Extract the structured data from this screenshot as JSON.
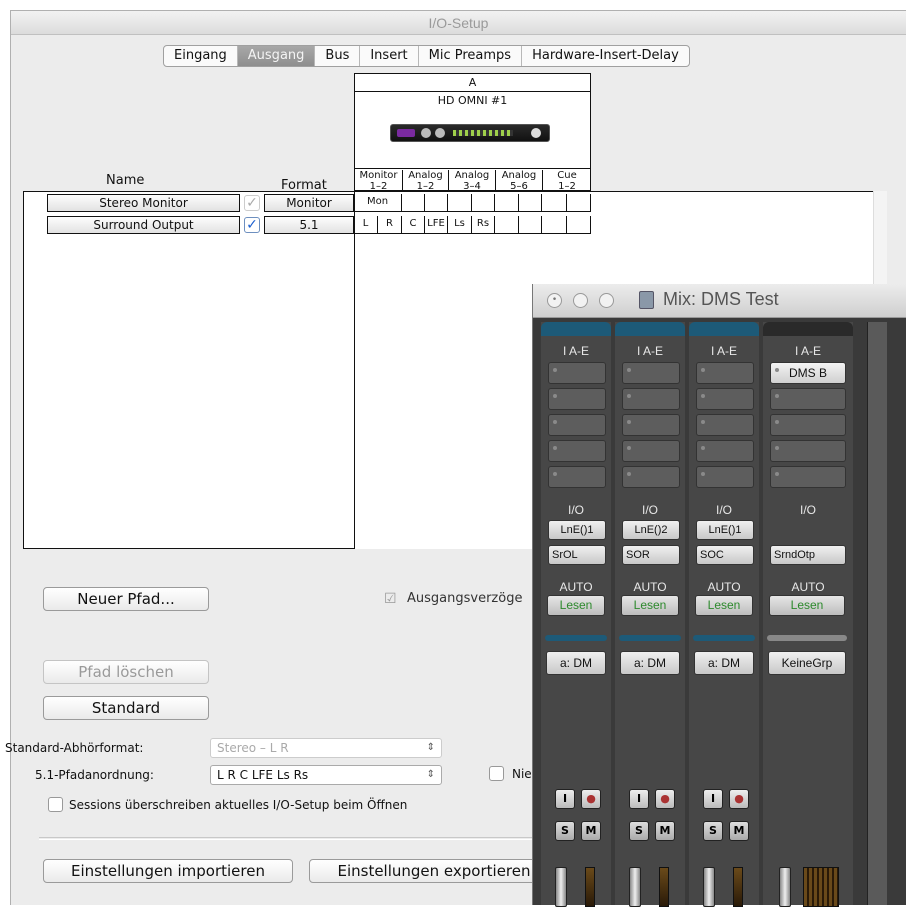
{
  "window": {
    "title": "I/O-Setup"
  },
  "tabs": [
    "Eingang",
    "Ausgang",
    "Bus",
    "Insert",
    "Mic Preamps",
    "Hardware-Insert-Delay"
  ],
  "active_tab": "Ausgang",
  "columns": {
    "name": "Name",
    "format": "Format"
  },
  "device": {
    "bank": "A",
    "name": "HD OMNI #1"
  },
  "channel_groups": [
    {
      "top": "Monitor",
      "bottom": "1–2"
    },
    {
      "top": "Analog",
      "bottom": "1–2"
    },
    {
      "top": "Analog",
      "bottom": "3–4"
    },
    {
      "top": "Analog",
      "bottom": "5–6"
    },
    {
      "top": "Cue",
      "bottom": "1–2"
    }
  ],
  "paths": [
    {
      "name": "Stereo Monitor",
      "format": "Monitor",
      "checked": true,
      "enabled": false,
      "assign": [
        "Mon"
      ]
    },
    {
      "name": "Surround Output",
      "format": "5.1",
      "checked": true,
      "enabled": true,
      "assign": [
        "L",
        "R",
        "C",
        "LFE",
        "Ls",
        "Rs"
      ]
    }
  ],
  "buttons": {
    "new_path": "Neuer Pfad...",
    "delete_path": "Pfad löschen",
    "default": "Standard",
    "import": "Einstellungen importieren",
    "export": "Einstellungen exportieren"
  },
  "output_delay_label": "Ausgangsverzöge",
  "default_monitor": {
    "label": "Standard-Abhörformat:",
    "value": "Stereo – L R"
  },
  "path_order": {
    "label": "5.1-Pfadanordnung:",
    "value": "L R C LFE Ls Rs"
  },
  "nie_label": "Nie",
  "sessions_label": "Sessions überschreiben aktuelles I/O-Setup beim Öffnen",
  "mix": {
    "title": "Mix: DMS Test",
    "strips": [
      {
        "inserts": "I A-E",
        "insert_slot": "",
        "io": "I/O",
        "in": "LnE()1",
        "out": "SrOL",
        "auto": "AUTO",
        "auto_mode": "Lesen",
        "group": "a: DM",
        "color": "#1d5a78"
      },
      {
        "inserts": "I A-E",
        "insert_slot": "",
        "io": "I/O",
        "in": "LnE()2",
        "out": "SOR",
        "auto": "AUTO",
        "auto_mode": "Lesen",
        "group": "a: DM",
        "color": "#1d5a78"
      },
      {
        "inserts": "I A-E",
        "insert_slot": "",
        "io": "I/O",
        "in": "LnE()1",
        "out": "SOC",
        "auto": "AUTO",
        "auto_mode": "Lesen",
        "group": "a: DM",
        "color": "#1d5a78"
      },
      {
        "inserts": "I A-E",
        "insert_slot": "DMS B",
        "io": "I/O",
        "in": "",
        "out": "SrndOtp",
        "auto": "AUTO",
        "auto_mode": "Lesen",
        "group": "KeineGrp",
        "color": "#2a2a2a"
      }
    ],
    "buttons": {
      "input": "I",
      "solo": "S",
      "mute": "M"
    }
  }
}
